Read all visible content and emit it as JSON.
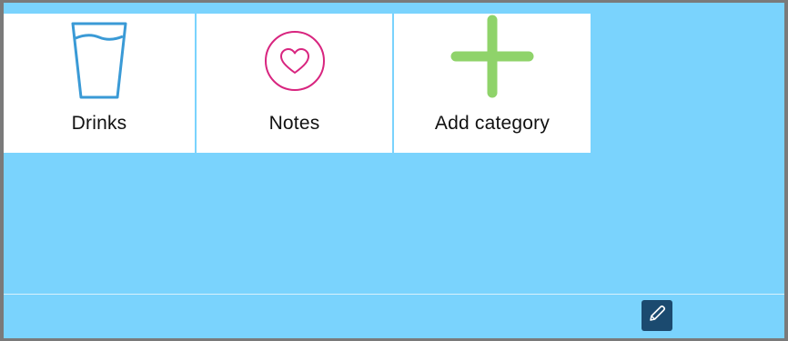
{
  "categories": [
    {
      "label": "Drinks",
      "icon": "drinking-glass-icon",
      "color": "#3a9ad6"
    },
    {
      "label": "Notes",
      "icon": "heart-circle-icon",
      "color": "#d8257f"
    },
    {
      "label": "Add category",
      "icon": "plus-icon",
      "color": "#8fd36a"
    }
  ],
  "toolbar": {
    "edit_icon": "pencil-icon"
  },
  "colors": {
    "background": "#7ad3fd",
    "tile": "#ffffff",
    "edit_button": "#1b4a6f"
  }
}
